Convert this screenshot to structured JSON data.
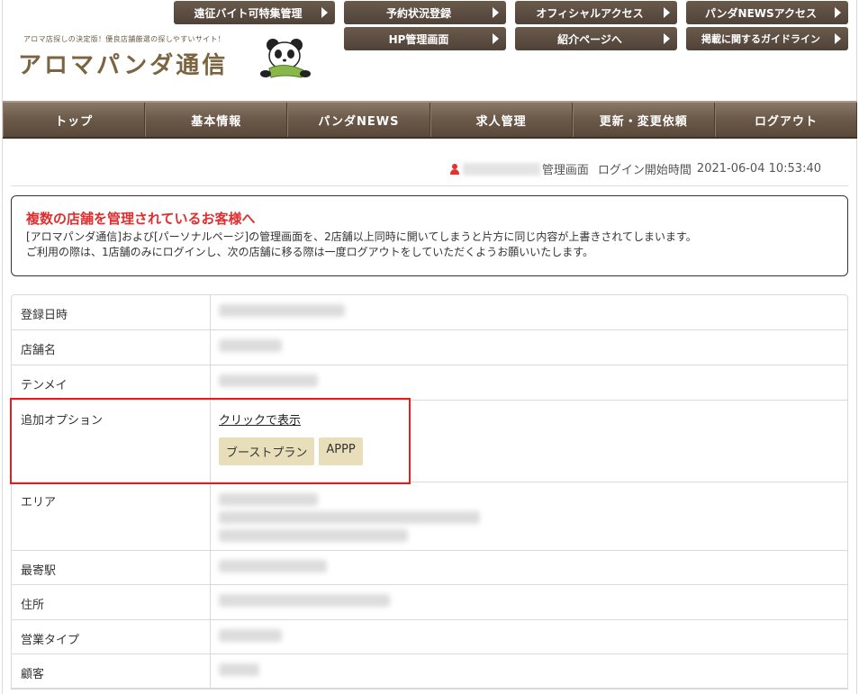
{
  "header": {
    "logo_tagline": "アロマ店探しの決定版！優良店舗厳選の探しやすいサイト！",
    "logo_title": "アロマパンダ通信",
    "top_buttons": [
      {
        "label": "遠征バイト可特集管理"
      },
      {
        "label": "予約状況登録"
      },
      {
        "label": "オフィシャルアクセス"
      },
      {
        "label": "パンダNEWSアクセス"
      },
      {
        "label": "HP管理画面"
      },
      {
        "label": "紹介ページへ"
      },
      {
        "label": "掲載に関するガイドライン"
      }
    ]
  },
  "nav": {
    "items": [
      {
        "label": "トップ"
      },
      {
        "label": "基本情報"
      },
      {
        "label": "パンダNEWS"
      },
      {
        "label": "求人管理"
      },
      {
        "label": "更新・変更依頼"
      },
      {
        "label": "ログアウト"
      }
    ]
  },
  "status": {
    "screen_label": "管理画面",
    "login_label": "ログイン開始時間",
    "login_time": "2021-06-04 10:53:40"
  },
  "notice": {
    "title": "複数の店舗を管理されているお客様へ",
    "line1": "[アロマパンダ通信]および[パーソナルページ]の管理画面を、2店舗以上同時に開いてしまうと片方に同じ内容が上書きされてしまいます。",
    "line2": "ご利用の際は、1店舗のみにログインし、次の店舗に移る際は一度ログアウトをしていただくようお願いいたします。"
  },
  "table": {
    "rows": [
      {
        "label": "登録日時"
      },
      {
        "label": "店舗名"
      },
      {
        "label": "テンメイ"
      },
      {
        "label": "追加オプション",
        "link": "クリックで表示",
        "tags": [
          "ブーストプラン",
          "APPP"
        ]
      },
      {
        "label": "エリア"
      },
      {
        "label": "最寄駅"
      },
      {
        "label": "住所"
      },
      {
        "label": "営業タイプ"
      },
      {
        "label": "顧客"
      }
    ]
  },
  "colors": {
    "notice_title": "#e12d2d",
    "highlight": "#e02020",
    "nav_bg": "#6c5a4a",
    "tag_bg": "#e8dfba"
  }
}
